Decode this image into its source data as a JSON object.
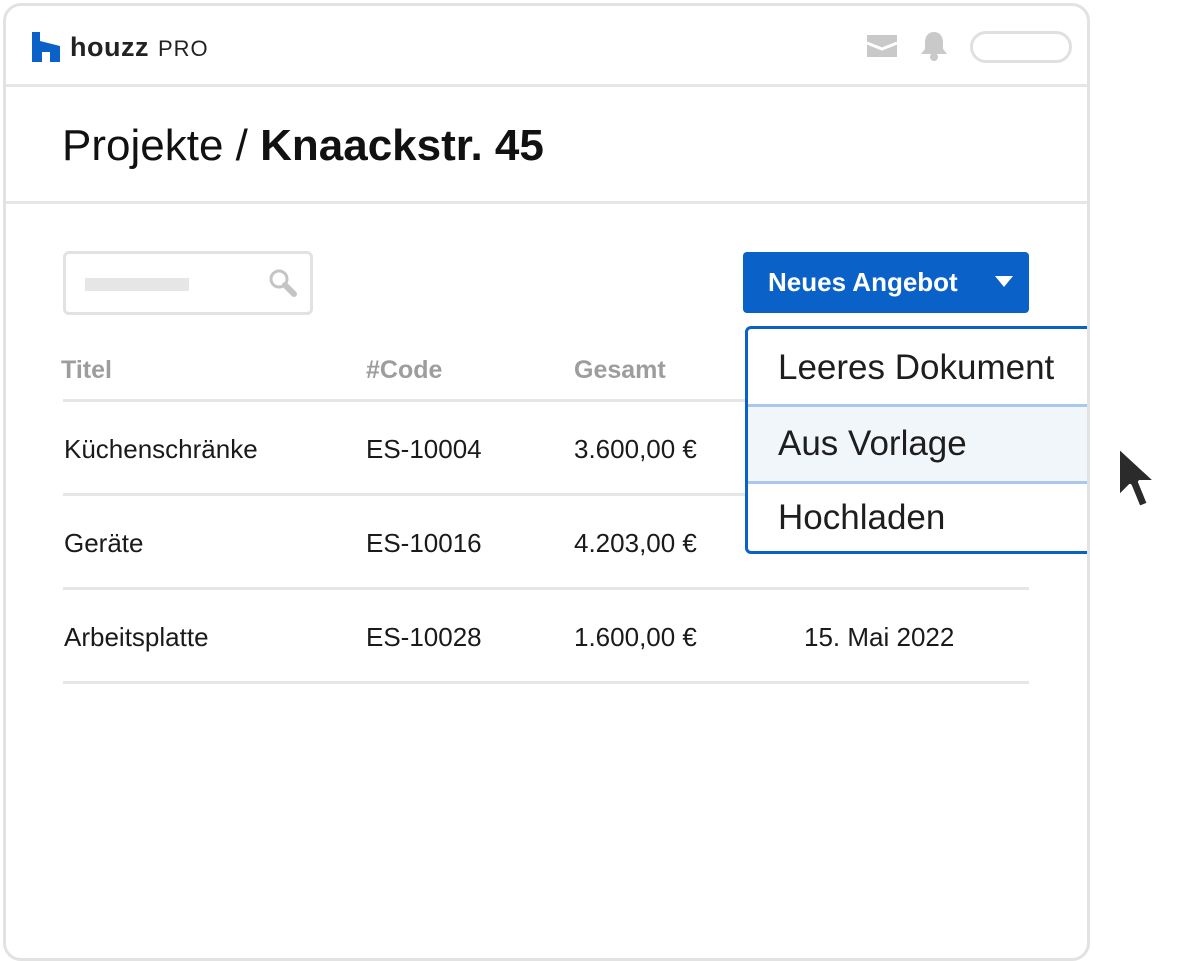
{
  "header": {
    "brand": "houzz",
    "brand_suffix": "PRO",
    "icons": [
      "logo-mark-icon",
      "inbox-icon",
      "bell-icon"
    ]
  },
  "page": {
    "breadcrumb_parent": "Projekte /",
    "breadcrumb_current": "Knaackstr. 45"
  },
  "toolbar": {
    "search_placeholder": "",
    "new_offer_label": "Neues Angebot"
  },
  "table": {
    "headers": [
      "Titel",
      "#Code",
      "Gesamt"
    ],
    "rows": [
      {
        "title": "Küchenschränke",
        "code": "ES-10004",
        "total": "3.600,00 €",
        "date": ""
      },
      {
        "title": "Geräte",
        "code": "ES-10016",
        "total": "4.203,00 €",
        "date": ""
      },
      {
        "title": "Arbeitsplatte",
        "code": "ES-10028",
        "total": "1.600,00 €",
        "date": "15. Mai 2022"
      }
    ]
  },
  "dropdown": {
    "items": [
      "Leeres Dokument",
      "Aus Vorlage",
      "Hochladen"
    ],
    "highlighted_index": 1
  },
  "colors": {
    "accent": "#0a62c8",
    "border": "#e2e2e2",
    "header_text": "#9d9d9d",
    "hover_bg": "#f1f6fb"
  }
}
